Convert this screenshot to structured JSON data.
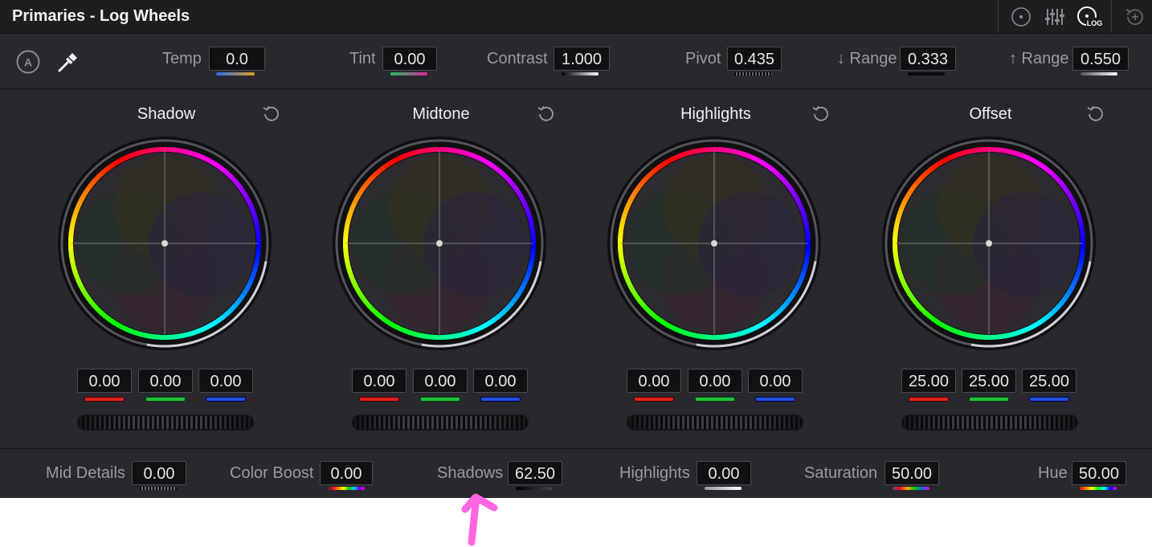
{
  "title": "Primaries - Log Wheels",
  "header_icons": [
    "primaries-wheel-icon",
    "bars-icon",
    "log-wheel-icon",
    "add-reset-icon"
  ],
  "log_icon_label": "LOG",
  "toolbar": {
    "auto_badge": "A",
    "temp": {
      "label": "Temp",
      "value": "0.0"
    },
    "tint": {
      "label": "Tint",
      "value": "0.00"
    },
    "contrast": {
      "label": "Contrast",
      "value": "1.000"
    },
    "pivot": {
      "label": "Pivot",
      "value": "0.435"
    },
    "low_range": {
      "label": "↓ Range",
      "value": "0.333"
    },
    "high_range": {
      "label": "↑ Range",
      "value": "0.550"
    }
  },
  "wheels": [
    {
      "name": "Shadow",
      "r": "0.00",
      "g": "0.00",
      "b": "0.00"
    },
    {
      "name": "Midtone",
      "r": "0.00",
      "g": "0.00",
      "b": "0.00"
    },
    {
      "name": "Highlights",
      "r": "0.00",
      "g": "0.00",
      "b": "0.00"
    },
    {
      "name": "Offset",
      "r": "25.00",
      "g": "25.00",
      "b": "25.00"
    }
  ],
  "bottom": {
    "mid_details": {
      "label": "Mid Details",
      "value": "0.00"
    },
    "color_boost": {
      "label": "Color Boost",
      "value": "0.00"
    },
    "shadows": {
      "label": "Shadows",
      "value": "62.50"
    },
    "highlights": {
      "label": "Highlights",
      "value": "0.00"
    },
    "saturation": {
      "label": "Saturation",
      "value": "50.00"
    },
    "hue": {
      "label": "Hue",
      "value": "50.00"
    }
  },
  "colors": {
    "annotation": "#ff66e0",
    "red": "#e02020",
    "green": "#20c040",
    "blue": "#2050e0"
  }
}
